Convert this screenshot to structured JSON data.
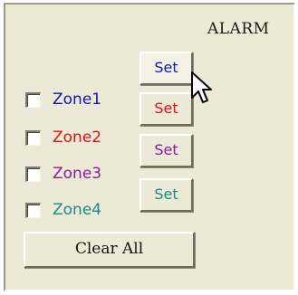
{
  "group": {
    "title": "ALARM"
  },
  "zones": [
    {
      "label": "Zone1",
      "checked": false,
      "color": "#1414b4",
      "set_label": "Set"
    },
    {
      "label": "Zone2",
      "checked": false,
      "color": "#e01010",
      "set_label": "Set"
    },
    {
      "label": "Zone3",
      "checked": false,
      "color": "#8a1aa0",
      "set_label": "Set"
    },
    {
      "label": "Zone4",
      "checked": false,
      "color": "#1a8a86",
      "set_label": "Set"
    }
  ],
  "clear_button": {
    "label": "Clear All"
  },
  "cursor": {
    "icon": "arrow-pointer-icon"
  }
}
